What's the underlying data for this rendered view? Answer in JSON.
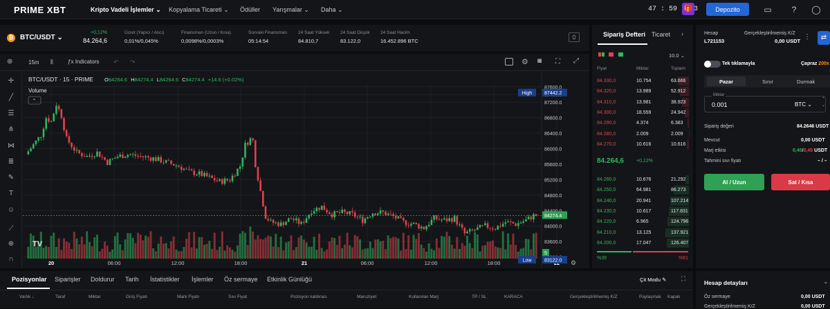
{
  "nav": {
    "logo": "PRIME XBT",
    "items": [
      "Kripto Vadeli İşlemler",
      "Kopyalama Ticareti",
      "Ödüller",
      "Yarışmalar",
      "Daha"
    ],
    "timer": "47 : 59 : 23",
    "deposit_label": "Depozito"
  },
  "ticker": {
    "pair": "BTC/USDT",
    "change": "+0,12%",
    "price": "84.264,6",
    "stats": [
      {
        "label": "Ücret (Yapıcı / Alıcı)",
        "value": "0,01%/0,045%"
      },
      {
        "label": "Finansman (Uzun / Kısa)",
        "value": "0,0098%/0,0003%"
      },
      {
        "label": "Sonraki Finansman",
        "value": "05:14:54"
      },
      {
        "label": "24 Saat Yüksek",
        "value": "84.810,7"
      },
      {
        "label": "24 Saat Düşük",
        "value": "83.122,0"
      },
      {
        "label": "24 Saat Hacim",
        "value": "16.452.896 BTC"
      }
    ]
  },
  "chart_toolbar": {
    "interval": "15m",
    "indicators_label": "Indicators"
  },
  "chart_data": {
    "type": "candlestick",
    "title": "BTC/USDT · 15 · PRIME",
    "ohlc_labels": {
      "o": "O",
      "h": "H",
      "l": "L",
      "c": "C"
    },
    "ohlc_values": {
      "o": "84264.6",
      "h": "84274.4",
      "l": "84264.6",
      "c": "84274.4",
      "change": "+14.6 (+0.02%)"
    },
    "volume_label": "Volume",
    "y_ticks": [
      87600,
      87400,
      87200,
      86800,
      86400,
      86000,
      85600,
      85200,
      84800,
      84400,
      84000,
      83600,
      83200
    ],
    "y_tick_labels": [
      "87600.0",
      "87400.0",
      "87200.0",
      "86800.0",
      "86400.0",
      "86000.0",
      "85600.0",
      "85200.0",
      "84800.0",
      "84400.0",
      "84000.0",
      "83600.0",
      "83200.0"
    ],
    "ylim": [
      83000,
      87800
    ],
    "x_ticks": [
      "20",
      "06:00",
      "12:00",
      "18:00",
      "21",
      "06:00",
      "12:00",
      "18:00",
      "22"
    ],
    "high_label": "High",
    "high_value": "87442.2",
    "low_label": "Low",
    "low_value": "83122.0",
    "last_value": "84274.4",
    "countdown": "5",
    "anchors": [
      [
        0,
        85850
      ],
      [
        6,
        86350
      ],
      [
        8,
        86800
      ],
      [
        10,
        86700
      ],
      [
        12,
        87150
      ],
      [
        14,
        86850
      ],
      [
        16,
        86250
      ],
      [
        20,
        85900
      ],
      [
        24,
        85800
      ],
      [
        28,
        85900
      ],
      [
        32,
        85650
      ],
      [
        36,
        85800
      ],
      [
        40,
        85850
      ],
      [
        45,
        85800
      ],
      [
        50,
        85750
      ],
      [
        55,
        85650
      ],
      [
        60,
        85550
      ],
      [
        64,
        85400
      ],
      [
        68,
        85350
      ],
      [
        72,
        85250
      ],
      [
        76,
        85150
      ],
      [
        80,
        85200
      ],
      [
        84,
        85550
      ],
      [
        86,
        86100
      ],
      [
        88,
        86250
      ],
      [
        89,
        86200
      ],
      [
        90,
        85600
      ],
      [
        92,
        84900
      ],
      [
        94,
        84250
      ],
      [
        96,
        84100
      ],
      [
        100,
        84050
      ],
      [
        104,
        84200
      ],
      [
        108,
        84050
      ],
      [
        112,
        84400
      ],
      [
        116,
        84500
      ],
      [
        120,
        84300
      ],
      [
        124,
        84350
      ],
      [
        128,
        84300
      ],
      [
        132,
        84150
      ],
      [
        136,
        84350
      ],
      [
        140,
        84350
      ],
      [
        144,
        84250
      ],
      [
        148,
        84100
      ],
      [
        152,
        84050
      ],
      [
        156,
        83950
      ],
      [
        160,
        84200
      ],
      [
        164,
        84150
      ],
      [
        168,
        84200
      ],
      [
        172,
        83800
      ],
      [
        176,
        83900
      ],
      [
        180,
        84000
      ],
      [
        184,
        83950
      ],
      [
        188,
        84100
      ],
      [
        192,
        84050
      ],
      [
        196,
        84150
      ],
      [
        199,
        84270
      ]
    ]
  },
  "orderbook": {
    "tab_orderbook": "Sipariş Defteri",
    "tab_trades": "Ticaret",
    "step": "10.0",
    "headers": [
      "Fiyat",
      "Miktar",
      "Toplam"
    ],
    "asks": [
      {
        "p": "84.330,0",
        "q": "10.754",
        "t": "63.666"
      },
      {
        "p": "84.320,0",
        "q": "13.989",
        "t": "52.912"
      },
      {
        "p": "84.310,0",
        "q": "13.981",
        "t": "38.923"
      },
      {
        "p": "84.300,0",
        "q": "18.559",
        "t": "24.942"
      },
      {
        "p": "84.290,0",
        "q": "4.374",
        "t": "6.383"
      },
      {
        "p": "84.280,0",
        "q": "2.009",
        "t": "2.009"
      },
      {
        "p": "84.270,0",
        "q": "10.616",
        "t": "10.616"
      }
    ],
    "mid_price": "84.264,6",
    "mid_change": "+0,12%",
    "bids": [
      {
        "p": "84.260,0",
        "q": "10.676",
        "t": "21.292"
      },
      {
        "p": "84.250,0",
        "q": "64.981",
        "t": "86.273"
      },
      {
        "p": "84.240,0",
        "q": "20.941",
        "t": "107.214"
      },
      {
        "p": "84.230,0",
        "q": "10.617",
        "t": "117.831"
      },
      {
        "p": "84.220,0",
        "q": "6.965",
        "t": "124.796"
      },
      {
        "p": "84.210,0",
        "q": "13.125",
        "t": "137.921"
      },
      {
        "p": "84.200,0",
        "q": "17.047",
        "t": "126.407"
      }
    ],
    "buy_pct": "%39",
    "sell_pct": "%61"
  },
  "account": {
    "account_label": "Hesap",
    "account_id": "L721153",
    "unrealized_label": "Gerçekleştirilmemiş K/Z",
    "unrealized_value": "0,00 USDT",
    "one_click_label": "Tek tıklamayla",
    "cross_label": "Çapraz",
    "leverage": "200x",
    "order_tabs": [
      "Pazar",
      "Sınır",
      "Durmak"
    ],
    "amount_label": "Miktar",
    "amount_value": "0.001",
    "amount_unit": "BTC",
    "order_value_label": "Sipariş değeri",
    "order_value": "84.2646 USDT",
    "available_label": "Mevcut",
    "available_value": "0,00 USDT",
    "margin_label": "Marj etkisi",
    "margin_buy": "0,45",
    "margin_sell": "0,45",
    "margin_unit": "USDT",
    "liq_label": "Tahmini sıvı fiyatı",
    "liq_value": "– / –",
    "buy_label": "Al / Uzun",
    "sell_label": "Sat / Kısa"
  },
  "bottom": {
    "tabs": [
      "Pozisyonlar",
      "Siparişler",
      "Doldurur",
      "Tarih",
      "İstatistikler",
      "İşlemler",
      "Öz sermaye",
      "Etkinlik Günlüğü"
    ],
    "mode_label": "Çit Modu",
    "columns": [
      "Varlık",
      "Taraf",
      "Miktar",
      "Giriş Fiyatı",
      "Mark Fiyatı",
      "Sıvı Fiyat",
      "Pozisyon kaldıracı",
      "Maruziyet",
      "Kullanılan Marj",
      "TP / SL",
      "KARACA",
      "Gerçekleştirilmemiş K/Z",
      "Paylaşmak",
      "Kapalı"
    ]
  },
  "account_details": {
    "title": "Hesap detayları",
    "equity_label": "Öz sermaye",
    "equity_value": "0,00 USDT",
    "unrealized_label": "Gerçekleştirilmemiş K/Z",
    "unrealized_value": "0,00 USDT"
  },
  "colors": {
    "up": "#2fb861",
    "down": "#e2424d",
    "accent": "#2466d6",
    "bg": "#141518"
  }
}
